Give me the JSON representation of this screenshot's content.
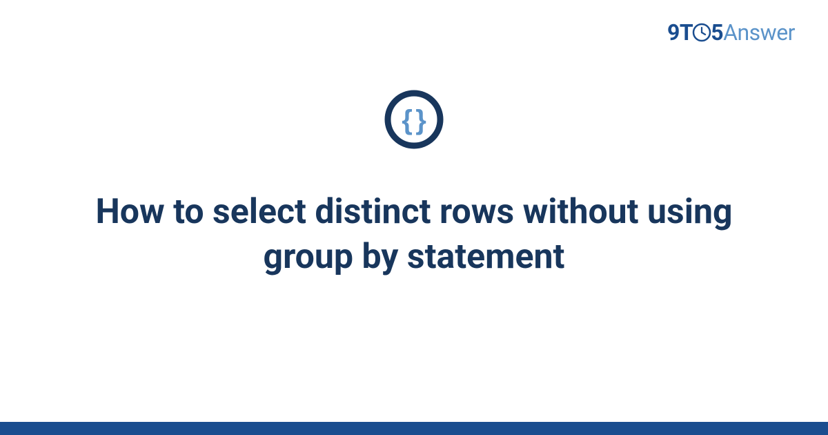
{
  "logo": {
    "part1": "9",
    "part2": "T",
    "part3": "5",
    "part4": "Answer"
  },
  "icon": {
    "brace_left": "{",
    "brace_right": "}"
  },
  "title": "How to select distinct rows without using group by statement",
  "colors": {
    "dark_blue": "#18365c",
    "mid_blue": "#1a4d8f",
    "light_blue": "#5b93c9"
  }
}
